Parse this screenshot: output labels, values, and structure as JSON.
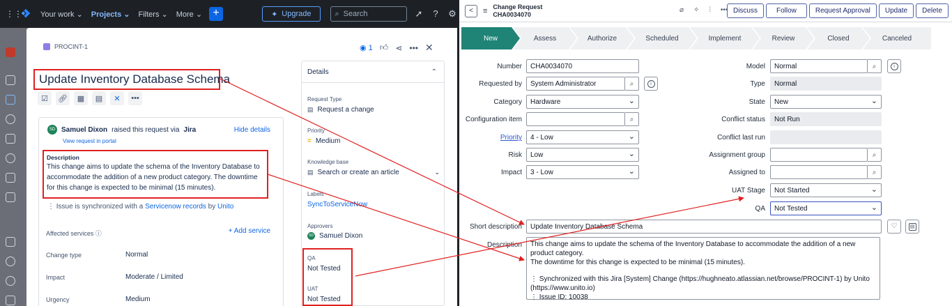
{
  "jira": {
    "nav": {
      "your_work": "Your work",
      "projects": "Projects",
      "filters": "Filters",
      "more": "More",
      "create": "+",
      "upgrade": "Upgrade",
      "search_placeholder": "Search"
    },
    "issue": {
      "key": "PROCINT-1",
      "watchers": "1",
      "title": "Update Inventory Database Schema",
      "reporter": "Samuel Dixon",
      "reporter_initials": "SD",
      "raised_text": "raised this request via",
      "raised_via": "Jira",
      "hide_details": "Hide details",
      "view_portal": "View request in portal",
      "description_label": "Description",
      "description": "This change aims to update the schema of the Inventory Database to accommodate the addition of a new product category. The downtime for this change is expected to be minimal (15 minutes).",
      "sync_prefix": "Issue is synchronized with a",
      "sync_link": "Servicenow records",
      "sync_by": "by",
      "sync_unito": "Unito",
      "affected_services": "Affected services",
      "add_service": "+ Add service",
      "fields": [
        {
          "label": "Change type",
          "value": "Normal"
        },
        {
          "label": "Impact",
          "value": "Moderate / Limited"
        },
        {
          "label": "Urgency",
          "value": "Medium"
        }
      ]
    },
    "details": {
      "title": "Details",
      "request_type_label": "Request Type",
      "request_type": "Request a change",
      "priority_label": "Priority",
      "priority": "Medium",
      "kb_label": "Knowledge base",
      "kb": "Search or create an article",
      "labels_label": "Labels",
      "labels": "SyncToServiceNow",
      "approvers_label": "Approvers",
      "approver": "Samuel Dixon",
      "approver_initials": "SD",
      "qa_label": "QA",
      "qa": "Not Tested",
      "uat_label": "UAT",
      "uat": "Not Tested"
    }
  },
  "servicenow": {
    "header": {
      "record_type": "Change Request",
      "number": "CHA0034070",
      "buttons": [
        "Discuss",
        "Follow",
        "Request Approval",
        "Update",
        "Delete"
      ]
    },
    "stages": [
      "New",
      "Assess",
      "Authorize",
      "Scheduled",
      "Implement",
      "Review",
      "Closed",
      "Canceled"
    ],
    "form": {
      "number_label": "Number",
      "number": "CHA0034070",
      "requested_by_label": "Requested by",
      "requested_by": "System Administrator",
      "category_label": "Category",
      "category": "Hardware",
      "config_item_label": "Configuration item",
      "config_item": "",
      "priority_label": "Priority",
      "priority": "4 - Low",
      "risk_label": "Risk",
      "risk": "Low",
      "impact_label": "Impact",
      "impact": "3 - Low",
      "model_label": "Model",
      "model": "Normal",
      "type_label": "Type",
      "type": "Normal",
      "state_label": "State",
      "state": "New",
      "conflict_status_label": "Conflict status",
      "conflict_status": "Not Run",
      "conflict_last_run_label": "Conflict last run",
      "conflict_last_run": "",
      "assignment_group_label": "Assignment group",
      "assignment_group": "",
      "assigned_to_label": "Assigned to",
      "assigned_to": "",
      "uat_stage_label": "UAT Stage",
      "uat_stage": "Not Started",
      "qa_label": "QA",
      "qa": "Not Tested",
      "short_desc_label": "Short description",
      "short_desc": "Update Inventory Database Schema",
      "description_label": "Description",
      "description_line1": "This change aims to update the schema of the Inventory Database to accommodate the addition of a new product category.",
      "description_line2": "The downtime for this change is expected to be minimal (15 minutes).",
      "description_sync": "Synchronized with this Jira [System] Change (https://hughneato.atlassian.net/browse/PROCINT-1) by Unito (https://www.unito.io)",
      "description_issue": "Issue ID: 10038"
    }
  },
  "colors": {
    "annotation": "#e02020",
    "jira_accent": "#0c66e4",
    "sn_active_stage": "#1f8476"
  }
}
